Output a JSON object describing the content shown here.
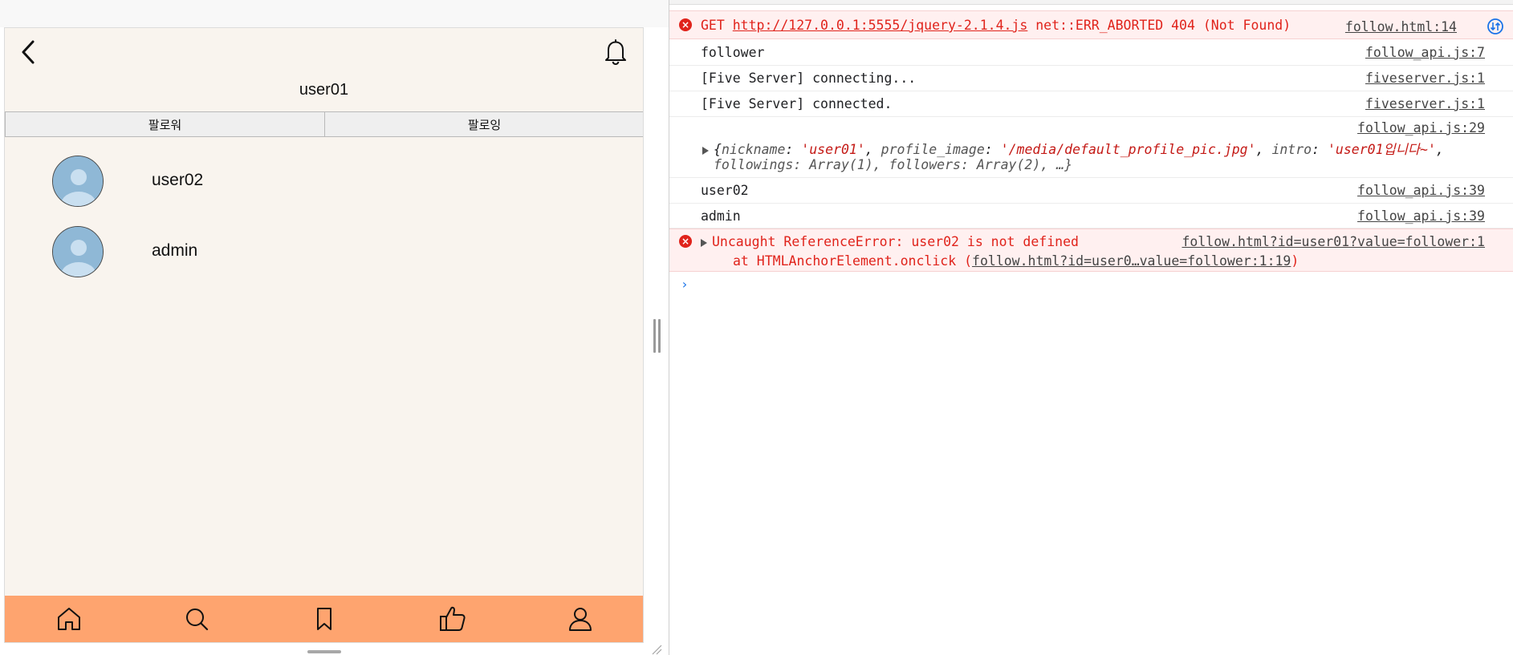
{
  "app": {
    "profile_title": "user01",
    "tabs": [
      {
        "label": "팔로워"
      },
      {
        "label": "팔로잉"
      }
    ],
    "users": [
      {
        "name": "user02"
      },
      {
        "name": "admin"
      }
    ],
    "colors": {
      "background": "#f9f4ee",
      "nav_bar": "#fea46f",
      "avatar": "#8fb8d6"
    },
    "icons": {
      "back": "chevron-left-icon",
      "notifications": "bell-icon",
      "nav": [
        "home-icon",
        "search-icon",
        "bookmark-icon",
        "thumbs-up-icon",
        "user-icon"
      ]
    }
  },
  "console": {
    "messages": [
      {
        "type": "error",
        "prefix": "GET ",
        "url": "http://127.0.0.1:5555/jquery-2.1.4.js",
        "suffix": " net::ERR_ABORTED 404 (Not Found)",
        "source": "follow.html:14"
      },
      {
        "type": "log",
        "text": "follower",
        "source": "follow_api.js:7"
      },
      {
        "type": "log",
        "text": "[Five Server] connecting...",
        "source": "fiveserver.js:1"
      },
      {
        "type": "log",
        "text": "[Five Server] connected.",
        "source": "fiveserver.js:1"
      },
      {
        "type": "object",
        "source": "follow_api.js:29",
        "line1": {
          "k1": "nickname",
          "v1": "'user01'",
          "k2": "profile_image",
          "v2": "'/media/default_profile_pic.jpg'",
          "k3": "intro",
          "v3": "'user01입니다~'"
        },
        "line2": "followings: Array(1), followers: Array(2), …}"
      },
      {
        "type": "log",
        "text": "user02",
        "source": "follow_api.js:39"
      },
      {
        "type": "log",
        "text": "admin",
        "source": "follow_api.js:39"
      },
      {
        "type": "error",
        "text": "Uncaught ReferenceError: user02 is not defined",
        "source": "follow.html?id=user01?value=follower:1",
        "trace_prefix": "at HTMLAnchorElement.onclick (",
        "trace_link": "follow.html?id=user0…value=follower:1:19",
        "trace_suffix": ")"
      }
    ],
    "prompt_symbol": "›",
    "colors": {
      "error_text": "#e0231b",
      "error_background": "#fff0f0",
      "string_value": "#c41a16"
    }
  }
}
